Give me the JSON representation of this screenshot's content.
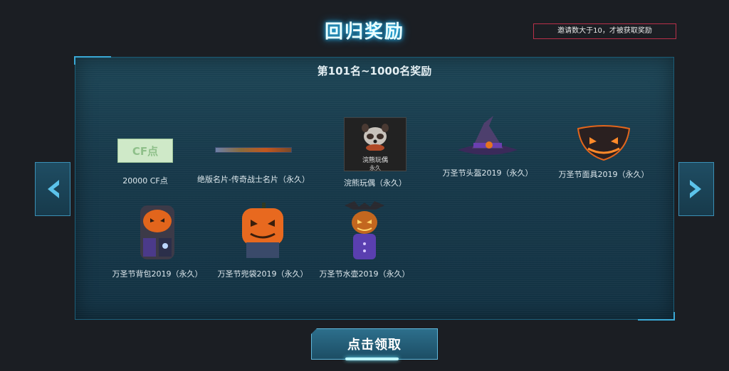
{
  "header": {
    "title": "回归奖励",
    "notice": "邀请数大于10，才被获取奖励"
  },
  "panel": {
    "rank_title": "第101名~1000名奖励",
    "items": [
      {
        "label": "20000 CF点",
        "icon": "cf-points-card-icon",
        "thumb_text": "CF点"
      },
      {
        "label": "绝版名片-传奇战士名片（永久）",
        "icon": "name-card-icon"
      },
      {
        "label": "浣熊玩偶（永久）",
        "icon": "raccoon-doll-icon",
        "thumb_caption": "浣熊玩偶",
        "thumb_sub": "永久"
      },
      {
        "label": "万圣节头盔2019（永久）",
        "icon": "witch-hat-icon"
      },
      {
        "label": "万圣节面具2019（永久）",
        "icon": "pumpkin-mask-icon"
      },
      {
        "label": "万圣节背包2019（永久）",
        "icon": "pumpkin-backpack-icon"
      },
      {
        "label": "万圣节兜袋2019（永久）",
        "icon": "pumpkin-pouch-icon"
      },
      {
        "label": "万圣节水壶2019（永久）",
        "icon": "pumpkin-kettle-icon"
      }
    ]
  },
  "nav": {
    "prev_icon": "chevron-left-icon",
    "next_icon": "chevron-right-icon"
  },
  "claim_button": {
    "label": "点击领取"
  },
  "colors": {
    "accent": "#2bc6ff",
    "notice_border": "#b8304a",
    "pumpkin": "#e2651c"
  }
}
